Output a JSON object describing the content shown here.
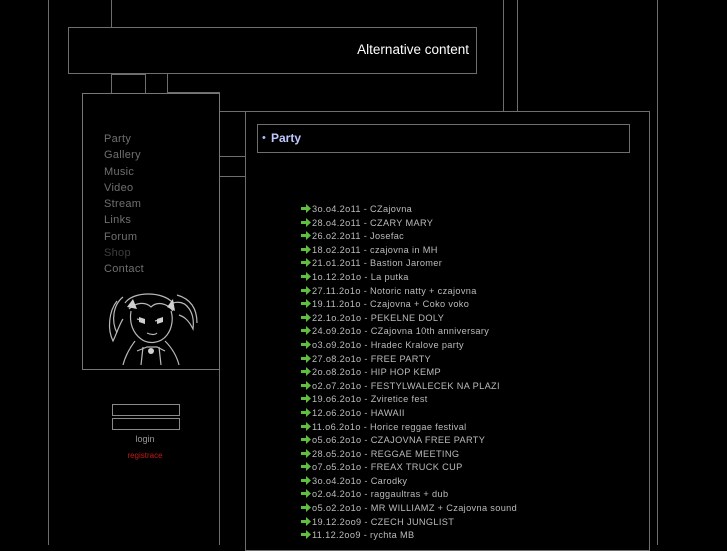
{
  "header": {
    "alternative_content": "Alternative content"
  },
  "nav": {
    "items": [
      {
        "label": "Party",
        "dim": false
      },
      {
        "label": "Gallery",
        "dim": false
      },
      {
        "label": "Music",
        "dim": false
      },
      {
        "label": "Video",
        "dim": false
      },
      {
        "label": "Stream",
        "dim": false
      },
      {
        "label": "Links",
        "dim": false
      },
      {
        "label": "Forum",
        "dim": false
      },
      {
        "label": "Shop",
        "dim": true
      },
      {
        "label": "Contact",
        "dim": false
      }
    ]
  },
  "login": {
    "username_value": "",
    "password_value": "",
    "login_label": "login",
    "register_label": "registrace"
  },
  "content": {
    "title_bullet": "•",
    "title": "Party",
    "events": [
      "3o.o4.2o11 - CZajovna",
      "28.o4.2o11 - CZARY MARY",
      "26.o2.2o11 - Josefac",
      "18.o2.2o11 - czajovna in MH",
      "21.o1.2o11 - Bastion Jaromer",
      "1o.12.2o1o - La putka",
      "27.11.2o1o - Notoric natty + czajovna",
      "19.11.2o1o - Czajovna + Coko voko",
      "22.1o.2o1o - PEKELNE DOLY",
      "24.o9.2o1o - CZajovna 10th anniversary",
      "o3.o9.2o1o - Hradec Kralove party",
      "27.o8.2o1o - FREE PARTY",
      "2o.o8.2o1o - HIP HOP KEMP",
      "o2.o7.2o1o - FESTYLWALECEK NA PLAZI",
      "19.o6.2o1o - Zviretice fest",
      "12.o6.2o1o - HAWAII",
      "11.o6.2o1o - Horice reggae festival",
      "o5.o6.2o1o - CZAJOVNA FREE PARTY",
      "28.o5.2o1o - REGGAE MEETING",
      "o7.o5.2o1o - FREAX TRUCK CUP",
      "3o.o4.2o1o - Carodky",
      "o2.o4.2o1o - raggaultras + dub",
      "o5.o2.2o1o - MR WILLIAMZ + Czajovna sound",
      "19.12.2oo9 - CZECH JUNGLIST",
      "11.12.2oo9 - rychta MB"
    ]
  },
  "colors": {
    "background": "#000000",
    "border": "#6e6e6e",
    "nav_text": "#6f6f6f",
    "title_text": "#bfc8ff",
    "arrow": "#5fbf3f",
    "register": "#c21b1b"
  },
  "icons": {
    "event_bullet": "green-arrow-icon"
  }
}
